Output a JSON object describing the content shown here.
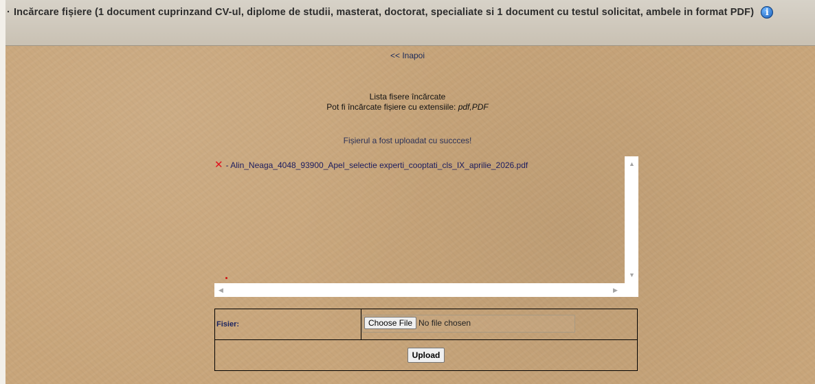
{
  "header": {
    "bullet": "·",
    "title": "Incărcare fișiere (1 document cuprinzand CV-ul, diplome de studii, masterat, doctorat, specialiate si 1 document cu testul solicitat, ambele in format PDF)",
    "info_icon": "info-icon"
  },
  "nav": {
    "back_label": "<< Inapoi"
  },
  "upload_info": {
    "list_title": "Lista fisere încărcate",
    "extensions_label": "Pot fi încărcate fișiere cu extensiile:",
    "extensions": "pdf,PDF"
  },
  "status": {
    "success_message": "Fișierul a fost uploadat cu succces!"
  },
  "files": [
    {
      "delete_icon": "✕",
      "name": "- Alin_Neaga_4048_93900_Apel_selectie experti_cooptati_cls_IX_aprilie_2026.pdf"
    }
  ],
  "form": {
    "file_label": "Fisier:",
    "choose_button": "Choose File",
    "no_file_text": "No file chosen",
    "upload_button": "Upload"
  },
  "colors": {
    "background": "#c8a57a",
    "delete": "#e0141e",
    "link": "#1b2a5a"
  }
}
